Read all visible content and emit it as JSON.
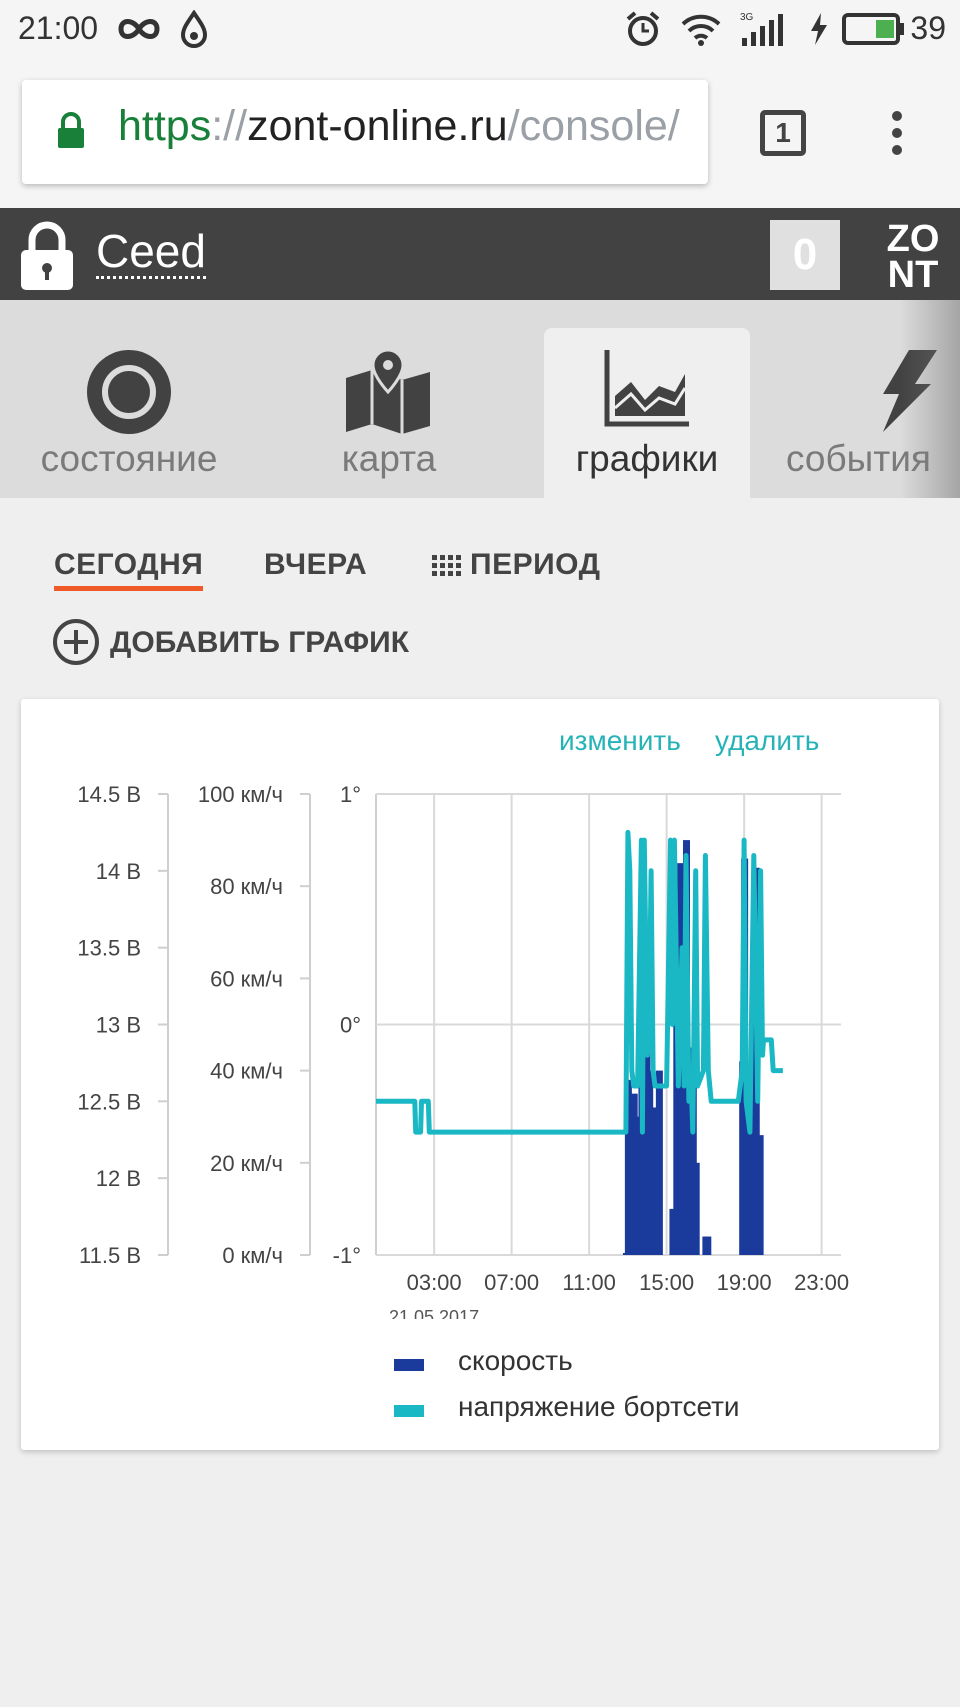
{
  "status_bar": {
    "time": "21:00",
    "battery_percent": "39"
  },
  "browser": {
    "url_scheme": "https",
    "url_sep": "://",
    "url_host": "zont-online.ru",
    "url_path": "/console/",
    "tabs_count": "1"
  },
  "header": {
    "title": "Ceed",
    "counter": "0",
    "logo_line1": "ZO",
    "logo_line2": "NT"
  },
  "nav": {
    "tabs": [
      {
        "label": "состояние",
        "icon": "circle-icon"
      },
      {
        "label": "карта",
        "icon": "map-icon"
      },
      {
        "label": "графики",
        "icon": "area-chart-icon"
      },
      {
        "label": "события",
        "icon": "bolt-icon"
      }
    ]
  },
  "subtabs": {
    "today": "СЕГОДНЯ",
    "yesterday": "ВЧЕРА",
    "period": "ПЕРИОД"
  },
  "add_chart": "ДОБАВИТЬ ГРАФИК",
  "card": {
    "edit": "изменить",
    "delete": "удалить"
  },
  "colors": {
    "accent": "#f05a28",
    "speed": "#1a3a9c",
    "voltage": "#1ab8c4",
    "link": "#26b3b7"
  },
  "chart_data": {
    "type": "line",
    "date_label": "21.05.2017",
    "x_ticks": [
      "03:00",
      "07:00",
      "11:00",
      "15:00",
      "19:00",
      "23:00"
    ],
    "x_range_hours": [
      0,
      24
    ],
    "axes": [
      {
        "name": "voltage",
        "unit": "В",
        "ticks": [
          "14.5 В",
          "14 В",
          "13.5 В",
          "13 В",
          "12.5 В",
          "12 В",
          "11.5 В"
        ],
        "range": [
          11.5,
          14.5
        ]
      },
      {
        "name": "speed",
        "unit": "км/ч",
        "ticks": [
          "100 км/ч",
          "80 км/ч",
          "60 км/ч",
          "40 км/ч",
          "20 км/ч",
          "0 км/ч"
        ],
        "range": [
          0,
          100
        ]
      },
      {
        "name": "angle",
        "ticks": [
          "1°",
          "0°",
          "-1°"
        ],
        "range": [
          -1,
          1
        ]
      }
    ],
    "series": [
      {
        "name": "скорость",
        "color": "#1a3a9c",
        "bars": [
          {
            "x": 12.9,
            "v": 0
          },
          {
            "x": 13.0,
            "v": 38
          },
          {
            "x": 13.1,
            "v": 26
          },
          {
            "x": 13.3,
            "v": 35
          },
          {
            "x": 13.5,
            "v": 30
          },
          {
            "x": 13.7,
            "v": 70
          },
          {
            "x": 13.8,
            "v": 78
          },
          {
            "x": 13.95,
            "v": 60
          },
          {
            "x": 14.1,
            "v": 40
          },
          {
            "x": 14.25,
            "v": 25
          },
          {
            "x": 14.4,
            "v": 32
          },
          {
            "x": 14.5,
            "v": 18
          },
          {
            "x": 14.6,
            "v": 40
          },
          {
            "x": 15.3,
            "v": 10
          },
          {
            "x": 15.5,
            "v": 80
          },
          {
            "x": 15.7,
            "v": 85
          },
          {
            "x": 15.85,
            "v": 30
          },
          {
            "x": 16.0,
            "v": 90
          },
          {
            "x": 16.1,
            "v": 45
          },
          {
            "x": 16.2,
            "v": 28
          },
          {
            "x": 16.35,
            "v": 40
          },
          {
            "x": 16.5,
            "v": 20
          },
          {
            "x": 17.0,
            "v": 4
          },
          {
            "x": 17.1,
            "v": 4
          },
          {
            "x": 18.9,
            "v": 42
          },
          {
            "x": 19.0,
            "v": 86
          },
          {
            "x": 19.3,
            "v": 35
          },
          {
            "x": 19.6,
            "v": 84
          },
          {
            "x": 19.8,
            "v": 26
          }
        ]
      },
      {
        "name": "напряжение бортсети",
        "color": "#1ab8c4",
        "points": [
          [
            0,
            12.5
          ],
          [
            2.0,
            12.5
          ],
          [
            2.05,
            12.3
          ],
          [
            2.3,
            12.3
          ],
          [
            2.35,
            12.5
          ],
          [
            2.7,
            12.5
          ],
          [
            2.75,
            12.3
          ],
          [
            12.9,
            12.3
          ],
          [
            13.0,
            14.25
          ],
          [
            13.1,
            14.0
          ],
          [
            13.2,
            12.7
          ],
          [
            13.3,
            12.6
          ],
          [
            13.5,
            12.6
          ],
          [
            13.7,
            14.2
          ],
          [
            13.75,
            12.3
          ],
          [
            13.85,
            14.2
          ],
          [
            14.0,
            12.8
          ],
          [
            14.1,
            13.0
          ],
          [
            14.2,
            14.0
          ],
          [
            14.3,
            12.7
          ],
          [
            14.4,
            12.6
          ],
          [
            14.6,
            12.6
          ],
          [
            15.0,
            12.6
          ],
          [
            15.2,
            14.2
          ],
          [
            15.3,
            13.0
          ],
          [
            15.4,
            14.2
          ],
          [
            15.6,
            12.6
          ],
          [
            15.8,
            13.5
          ],
          [
            15.9,
            12.6
          ],
          [
            16.0,
            14.1
          ],
          [
            16.15,
            12.5
          ],
          [
            16.25,
            12.7
          ],
          [
            16.35,
            12.3
          ],
          [
            16.5,
            14.0
          ],
          [
            16.6,
            12.6
          ],
          [
            16.9,
            12.7
          ],
          [
            17.0,
            14.1
          ],
          [
            17.15,
            12.7
          ],
          [
            17.3,
            12.5
          ],
          [
            17.5,
            12.5
          ],
          [
            18.0,
            12.5
          ],
          [
            18.7,
            12.5
          ],
          [
            18.9,
            12.7
          ],
          [
            19.0,
            14.2
          ],
          [
            19.1,
            12.5
          ],
          [
            19.3,
            12.3
          ],
          [
            19.5,
            14.1
          ],
          [
            19.7,
            12.5
          ],
          [
            19.85,
            14.0
          ],
          [
            19.95,
            12.8
          ],
          [
            20.0,
            12.9
          ],
          [
            20.4,
            12.9
          ],
          [
            20.5,
            12.7
          ],
          [
            21.0,
            12.7
          ]
        ]
      }
    ]
  }
}
